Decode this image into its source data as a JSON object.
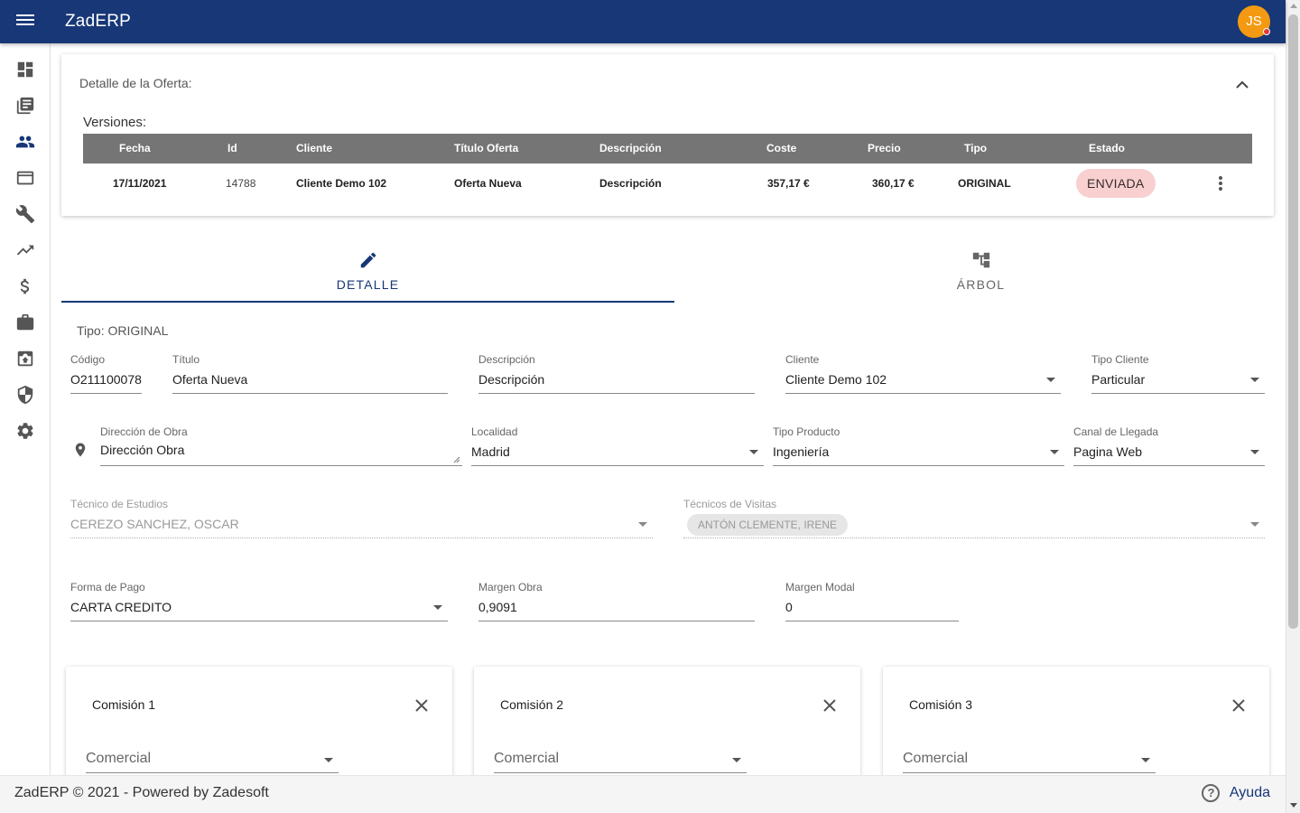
{
  "app": {
    "title": "ZadERP",
    "user_initials": "JS"
  },
  "sidebar": {
    "items": [
      {
        "icon": "dashboard-icon"
      },
      {
        "icon": "library-books-icon"
      },
      {
        "icon": "people-icon"
      },
      {
        "icon": "web-window-icon"
      },
      {
        "icon": "wrench-icon"
      },
      {
        "icon": "trending-up-icon"
      },
      {
        "icon": "dollar-icon"
      },
      {
        "icon": "briefcase-icon"
      },
      {
        "icon": "archive-icon"
      },
      {
        "icon": "shield-icon"
      },
      {
        "icon": "gear-icon"
      }
    ]
  },
  "offer_panel": {
    "title": "Detalle de la Oferta:",
    "versions_label": "Versiones:",
    "columns": [
      "Fecha",
      "Id",
      "Cliente",
      "Título Oferta",
      "Descripción",
      "Coste",
      "Precio",
      "Tipo",
      "Estado"
    ],
    "rows": [
      {
        "fecha": "17/11/2021",
        "id": "14788",
        "cliente": "Cliente Demo 102",
        "titulo": "Oferta Nueva",
        "descripcion": "Descripción",
        "coste": "357,17 €",
        "precio": "360,17 €",
        "tipo": "ORIGINAL",
        "estado": "ENVIADA"
      }
    ]
  },
  "tabs": [
    {
      "label": "DETALLE",
      "icon": "pencil-icon",
      "active": true
    },
    {
      "label": "ÁRBOL",
      "icon": "tree-icon",
      "active": false
    }
  ],
  "form": {
    "tipo_line": "Tipo: ORIGINAL",
    "codigo": {
      "label": "Código",
      "value": "O211100078"
    },
    "titulo": {
      "label": "Título",
      "value": "Oferta Nueva"
    },
    "descripcion": {
      "label": "Descripción",
      "value": "Descripción"
    },
    "cliente": {
      "label": "Cliente",
      "value": "Cliente Demo 102"
    },
    "tipo_cliente": {
      "label": "Tipo Cliente",
      "value": "Particular"
    },
    "direccion": {
      "label": "Dirección de Obra",
      "value": "Dirección Obra"
    },
    "localidad": {
      "label": "Localidad",
      "value": "Madrid"
    },
    "tipo_producto": {
      "label": "Tipo Producto",
      "value": "Ingeniería"
    },
    "canal": {
      "label": "Canal de Llegada",
      "value": "Pagina Web"
    },
    "tecnico_estudios": {
      "label": "Técnico de Estudios",
      "value": "CEREZO SANCHEZ, OSCAR"
    },
    "tecnicos_visitas": {
      "label": "Técnicos de Visitas",
      "chip": "ANTÓN CLEMENTE, IRENE"
    },
    "forma_pago": {
      "label": "Forma de Pago",
      "value": "CARTA CREDITO"
    },
    "margen_obra": {
      "label": "Margen Obra",
      "value": "0,9091"
    },
    "margen_modal": {
      "label": "Margen Modal",
      "value": "0"
    }
  },
  "commissions": [
    {
      "title": "Comisión 1",
      "field_value": "Comercial"
    },
    {
      "title": "Comisión 2",
      "field_value": "Comercial"
    },
    {
      "title": "Comisión 3",
      "field_value": "Comercial"
    }
  ],
  "footer": {
    "text": "ZadERP © 2021 - Powered by Zadesoft",
    "help_label": "Ayuda"
  },
  "colors": {
    "primary": "#173777",
    "accent": "#f39a12",
    "status_chip_bg": "#f8d0d0",
    "table_header_bg": "#757575"
  }
}
